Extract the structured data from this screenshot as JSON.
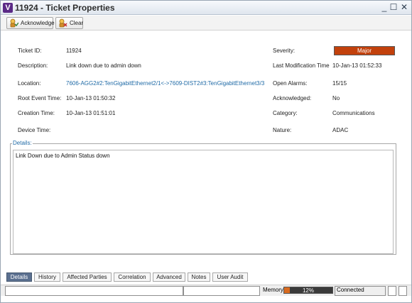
{
  "window": {
    "title": "11924 - Ticket Properties"
  },
  "toolbar": {
    "acknowledge_label": "Acknowledge",
    "clear_label": "Clear"
  },
  "fields": {
    "ticket_id_label": "Ticket ID:",
    "ticket_id": "11924",
    "description_label": "Description:",
    "description": "Link down due to admin down",
    "location_label": "Location:",
    "location": "7606-AGG2#2:TenGigabitEthernet2/1<->7609-DIST2#3:TenGigabitEthernet3/3",
    "root_event_time_label": "Root Event Time:",
    "root_event_time": "10-Jan-13 01:50:32",
    "creation_time_label": "Creation Time:",
    "creation_time": "10-Jan-13 01:51:01",
    "device_time_label": "Device Time:",
    "device_time": "",
    "severity_label": "Severity:",
    "severity": "Major",
    "last_modification_label": "Last Modification Time",
    "last_modification": "10-Jan-13 01:52:33",
    "open_alarms_label": "Open Alarms:",
    "open_alarms": "15/15",
    "acknowledged_label": "Acknowledged:",
    "acknowledged": "No",
    "category_label": "Category:",
    "category": "Communications",
    "nature_label": "Nature:",
    "nature": "ADAC"
  },
  "details": {
    "legend": "Details:",
    "text": "Link Down due to Admin Status down"
  },
  "tabs": [
    {
      "label": "Details",
      "active": true
    },
    {
      "label": "History",
      "active": false
    },
    {
      "label": "Affected Parties",
      "active": false
    },
    {
      "label": "Correlation",
      "active": false
    },
    {
      "label": "Advanced",
      "active": false
    },
    {
      "label": "Notes",
      "active": false
    },
    {
      "label": "User Audit",
      "active": false
    }
  ],
  "statusbar": {
    "memory_label": "Memory:",
    "memory_value_text": "12%",
    "memory_fraction": 0.12,
    "connection": "Connected"
  },
  "colors": {
    "severity_major": "#c2410c",
    "link": "#1f6aa6",
    "active_tab": "#5b7090",
    "memory_fill": "#d96b1f"
  },
  "icons": {
    "app": "v-app-icon",
    "acknowledge": "acknowledge-icon",
    "clear": "clear-icon"
  }
}
